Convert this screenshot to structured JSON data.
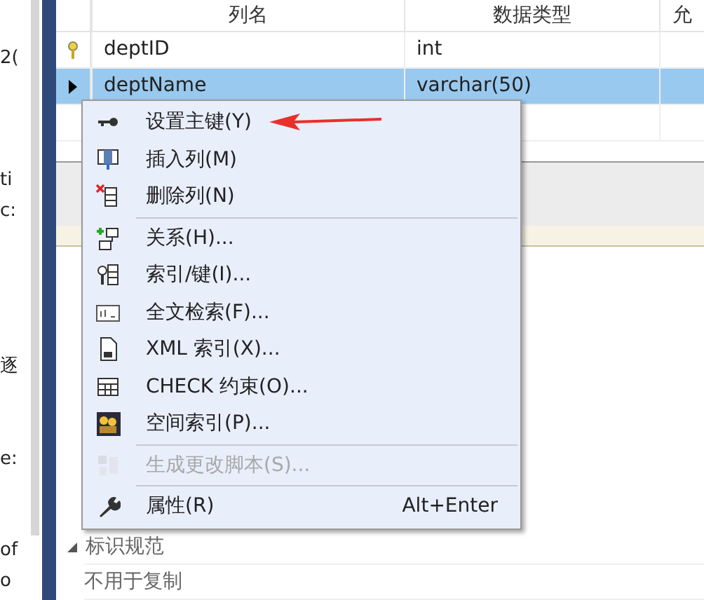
{
  "left_panel": {
    "fragments": [
      "2(",
      "ti",
      "c:",
      "逐",
      "e:",
      "of",
      "o"
    ]
  },
  "table": {
    "columns": [
      "列名",
      "数据类型",
      "允"
    ],
    "rows": [
      {
        "primary_key": true,
        "selected": false,
        "cells": [
          "deptID",
          "int"
        ]
      },
      {
        "primary_key": false,
        "selected": true,
        "cells": [
          "deptName",
          "varchar(50)"
        ]
      }
    ]
  },
  "properties": {
    "rows": [
      "标识规范",
      "不用于复制"
    ]
  },
  "context_menu": {
    "groups": [
      [
        {
          "label": "设置主键(Y)",
          "disabled": false
        },
        {
          "label": "插入列(M)",
          "disabled": false
        },
        {
          "label": "删除列(N)",
          "disabled": false
        }
      ],
      [
        {
          "label": "关系(H)...",
          "disabled": false
        },
        {
          "label": "索引/键(I)...",
          "disabled": false
        },
        {
          "label": "全文检索(F)...",
          "disabled": false
        },
        {
          "label": "XML 索引(X)...",
          "disabled": false
        },
        {
          "label": "CHECK 约束(O)...",
          "disabled": false
        },
        {
          "label": "空间索引(P)...",
          "disabled": false
        }
      ],
      [
        {
          "label": "生成更改脚本(S)...",
          "disabled": true
        }
      ],
      [
        {
          "label": "属性(R)",
          "shortcut": "Alt+Enter",
          "disabled": false
        }
      ]
    ]
  }
}
